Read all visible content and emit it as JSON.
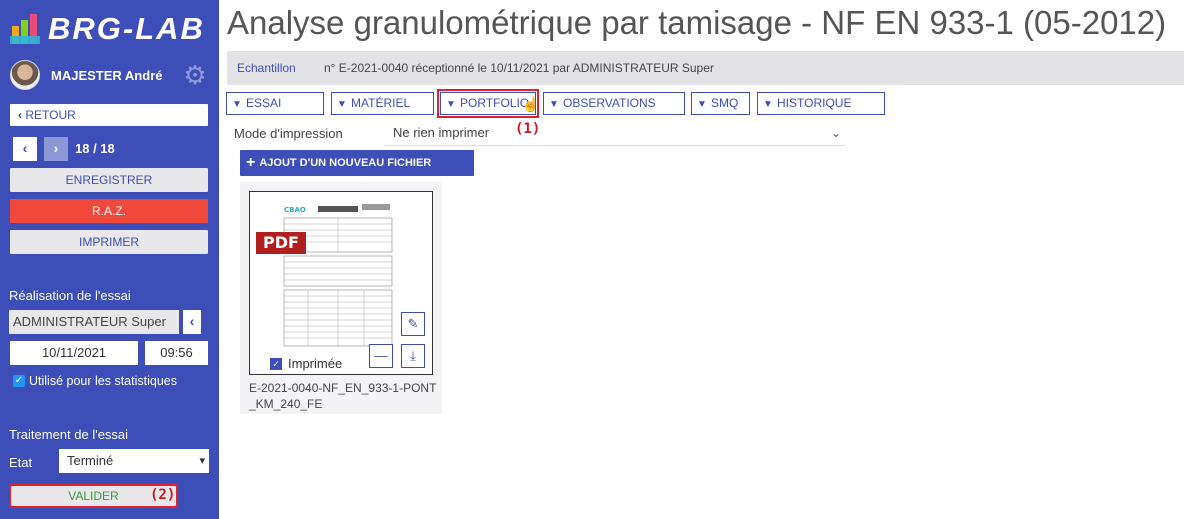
{
  "brand": {
    "name": "BRG-LAB"
  },
  "user": {
    "name": "MAJESTER André"
  },
  "sidebar": {
    "back_label": "RETOUR",
    "pager": "18 / 18",
    "save_label": "ENREGISTRER",
    "reset_label": "R.A.Z.",
    "print_label": "IMPRIMER",
    "realisation_title": "Réalisation de l'essai",
    "operator": "ADMINISTRATEUR Super",
    "date": "10/11/2021",
    "time": "09:56",
    "stats_label": "Utilisé pour les statistiques",
    "treatment_title": "Traitement de l'essai",
    "state_label": "Etat",
    "state_value": "Terminé",
    "validate_label": "VALIDER",
    "annotation_2": "(2)"
  },
  "page": {
    "title": "Analyse granulométrique par tamisage - NF EN 933-1 (05-2012)",
    "sample_link": "Echantillon",
    "sample_info": "n° E-2021-0040 réceptionné le 10/11/2021 par ADMINISTRATEUR Super"
  },
  "tabs": [
    {
      "label": "ESSAI"
    },
    {
      "label": "MATÉRIEL"
    },
    {
      "label": "PORTFOLIO"
    },
    {
      "label": "OBSERVATIONS"
    },
    {
      "label": "SMQ"
    },
    {
      "label": "HISTORIQUE"
    }
  ],
  "annotation_1": "(1)",
  "print_mode": {
    "label": "Mode d'impression",
    "value": "Ne rien imprimer"
  },
  "add_file_label": "AJOUT D'UN NOUVEAU FICHIER",
  "file_card": {
    "pdf_badge": "PDF",
    "doc_logo": "CBAO",
    "printed_label": "Imprimée",
    "filename": "E-2021-0040-NF_EN_933-1-PONT_KM_240_FE"
  },
  "colors": {
    "sidebar": "#3d4eb8",
    "accent": "#3d4eb8",
    "reset": "#f0493b",
    "annotation": "#d0141e"
  }
}
